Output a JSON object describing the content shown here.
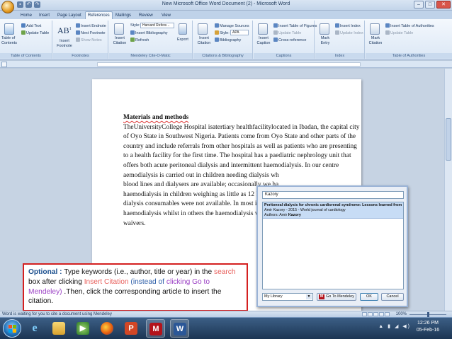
{
  "window": {
    "title": "New Microsoft Office Word Document (2) - Microsoft Word",
    "controls": [
      "–",
      "□",
      "✕"
    ]
  },
  "tabs": [
    "Home",
    "Insert",
    "Page Layout",
    "References",
    "Mailings",
    "Review",
    "View"
  ],
  "active_tab": "References",
  "ribbon": {
    "toc": {
      "label": "Table of Contents",
      "button": "Table of Contents",
      "add_text": "Add Text",
      "update_table": "Update Table"
    },
    "footnotes": {
      "label": "Footnotes",
      "insert_footnote": "Insert Footnote",
      "insert_endnote": "Insert Endnote",
      "next_footnote": "Next Footnote",
      "show_notes": "Show Notes"
    },
    "mendeley": {
      "label": "Mendeley Cite-O-Matic",
      "insert_citation": "Insert Citation",
      "style_label": "Style:",
      "style_value": "Harvard Refere...",
      "insert_bibliography": "Insert Bibliography",
      "refresh": "Refresh",
      "export": "Export"
    },
    "citations": {
      "label": "Citations & Bibliography",
      "insert_citation": "Insert Citation",
      "manage_sources": "Manage Sources",
      "style_label": "Style:",
      "style_value": "APA",
      "bibliography": "Bibliography"
    },
    "captions": {
      "label": "Captions",
      "insert_caption": "Insert Caption",
      "insert_table_of_figures": "Insert Table of Figures",
      "update_table": "Update Table",
      "cross_reference": "Cross-reference"
    },
    "index": {
      "label": "Index",
      "mark_entry": "Mark Entry",
      "insert_index": "Insert Index",
      "update_index": "Update Index"
    },
    "authorities": {
      "label": "Table of Authorities",
      "mark_citation": "Mark Citation",
      "insert_table": "Insert Table of Authorities",
      "update_table": "Update Table"
    }
  },
  "document": {
    "heading": "Materials and methods",
    "lines": [
      "TheUniversityCollege Hospital isatertiary healthfacilitylocated in Ibadan, the capital city",
      "of Oyo State in Southwest Nigeria. Patients come from Oyo State and other parts of the",
      "country and include referrals from other hospitals as well as patients who are presenting",
      "to a health facility for the first time. The hospital has a paediatric nephrology unit that",
      "offers both acute peritoneal dialysis and intermittent haemodialysis. In our centre",
      "aemodialysis is carried out in children needing dialysis wh",
      "blood lines and dialysers are available; occasionally we ha",
      "haemodialysis in children weighing as little as 12 kg, part",
      "dialysis consumables were not available. In most instance",
      "haemodialysis whilst in others the haemodialysis was carr",
      "waivers."
    ]
  },
  "dialog": {
    "search_value": "Kazory",
    "result": {
      "title": "Peritoneal dialysis for chronic cardiorenal syndrome: Lessons learned from e",
      "meta": "Amir Kazory - 2015 - World journal of cardiology",
      "authors_prefix": "Authors: Amir ",
      "authors_highlight": "Kazory"
    },
    "library_select": "My Library",
    "go_to_mendeley": "Go To Mendeley",
    "ok": "OK",
    "cancel": "Cancel"
  },
  "callout": {
    "optional": "Optional :",
    "t1": " Type keywords (i.e., author, title or year) in the ",
    "search": "search",
    "t2": " box after clicking ",
    "insert_citation": "Insert Citation",
    "t3": " (",
    "instead_of": "instead of",
    "t4": " ",
    "clicking_go": "clicking Go to Mendeley)",
    "t5": " .Then, click the corresponding article to insert the citation."
  },
  "status": {
    "text": "Word is waiting for you to cite a document using Mendeley",
    "zoom": "100%"
  },
  "taskbar": {
    "time": "12:26 PM",
    "date": "05-Feb-16",
    "tray": "▲ ▮ ◢ ◀)"
  },
  "colors": {
    "callout_border": "#d42020",
    "mendeley_red": "#b3131b",
    "selection_blue": "#c7dcf5"
  }
}
